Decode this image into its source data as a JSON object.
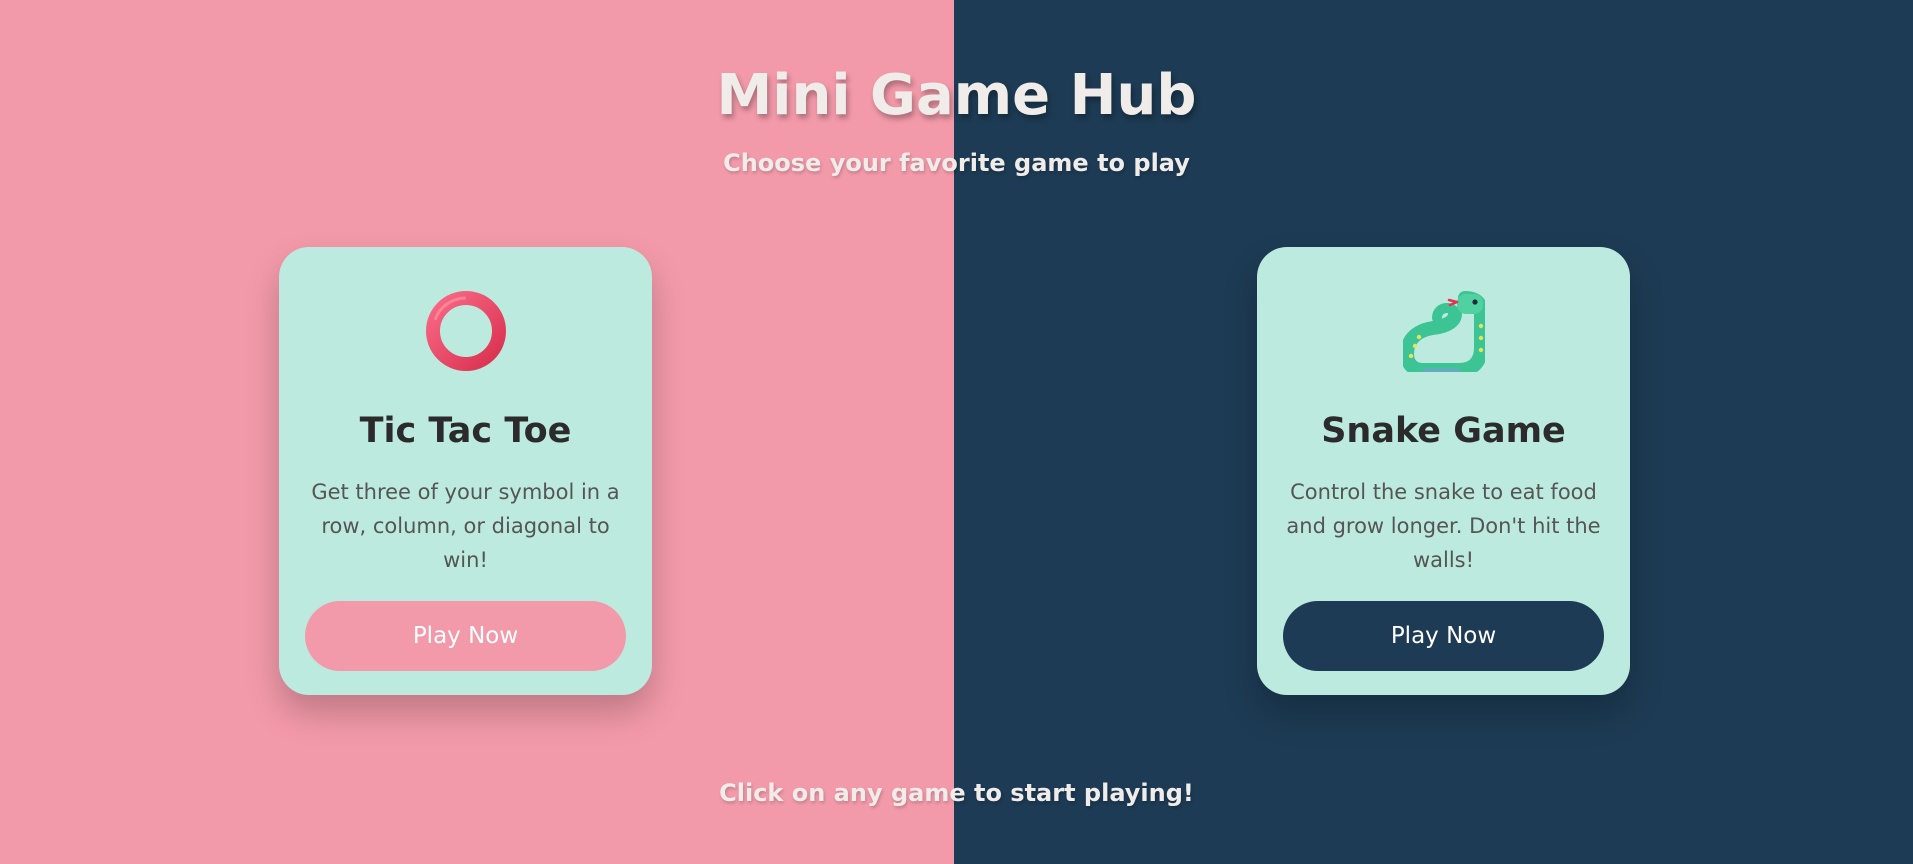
{
  "header": {
    "title": "Mini Game Hub",
    "subtitle": "Choose your favorite game to play"
  },
  "games": [
    {
      "icon": "ring-icon",
      "title": "Tic Tac Toe",
      "description": "Get three of your symbol in a row, column, or diagonal to win!",
      "button_label": "Play Now",
      "button_color": "#f39aaa"
    },
    {
      "icon": "snake-icon",
      "title": "Snake Game",
      "description": "Control the snake to eat food and grow longer. Don't hit the walls!",
      "button_label": "Play Now",
      "button_color": "#1d3b54"
    }
  ],
  "footer": {
    "text": "Click on any game to start playing!"
  },
  "colors": {
    "left_background": "#f39aaa",
    "right_background": "#1d3b54",
    "card_background": "#bdeade"
  }
}
